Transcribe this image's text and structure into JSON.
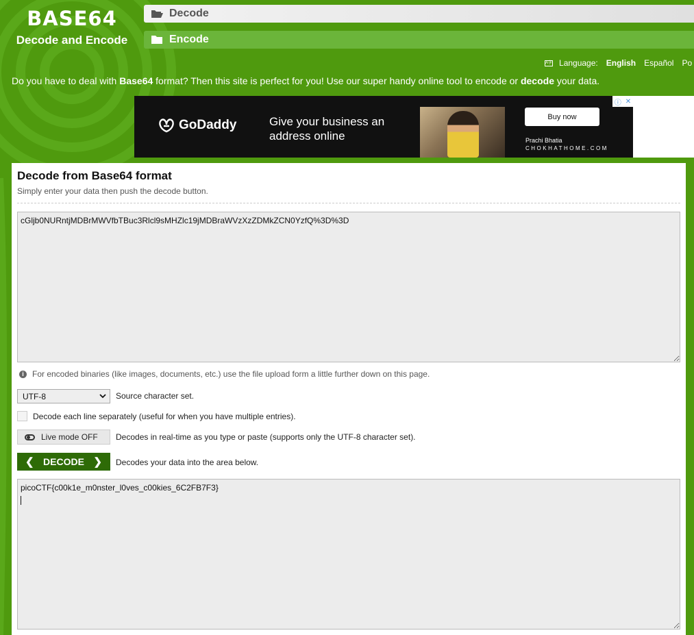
{
  "logo": {
    "title": "BASE64",
    "subtitle": "Decode and Encode"
  },
  "nav": {
    "decode_label": "Decode",
    "encode_label": "Encode"
  },
  "language": {
    "label": "Language:",
    "options": [
      "English",
      "Español",
      "Po"
    ],
    "active": "English"
  },
  "tagline": {
    "part1": "Do you have to deal with ",
    "bold1": "Base64",
    "part2": " format? Then this site is perfect for you! Use our super handy online tool to encode or ",
    "bold2": "decode",
    "part3": " your data."
  },
  "ad": {
    "brand": "GoDaddy",
    "headline": "Give your business an address online",
    "button": "Buy now",
    "credit_name": "Prachi Bhatia",
    "credit_site": "CHOKHATHOME.COM"
  },
  "panel": {
    "title": "Decode from Base64 format",
    "subtitle": "Simply enter your data then push the decode button.",
    "input_value": "cGljb0NURntjMDBrMWVfbTBuc3Rlcl9sMHZlc19jMDBraWVzXzZDMkZCN0YzfQ%3D%3D",
    "info_text": "For encoded binaries (like images, documents, etc.) use the file upload form a little further down on this page.",
    "charset_value": "UTF-8",
    "charset_label": "Source character set.",
    "line_sep_label": "Decode each line separately (useful for when you have multiple entries).",
    "live_mode_label": "Live mode OFF",
    "live_mode_desc": "Decodes in real-time as you type or paste (supports only the UTF-8 character set).",
    "decode_button": "DECODE",
    "decode_desc": "Decodes your data into the area below.",
    "output_value": "picoCTF{c00k1e_m0nster_l0ves_c00kies_6C2FB7F3}"
  },
  "colors": {
    "brand_green": "#4f9a0e",
    "button_green": "#2e6b07",
    "nav_green": "#6bb53a"
  }
}
